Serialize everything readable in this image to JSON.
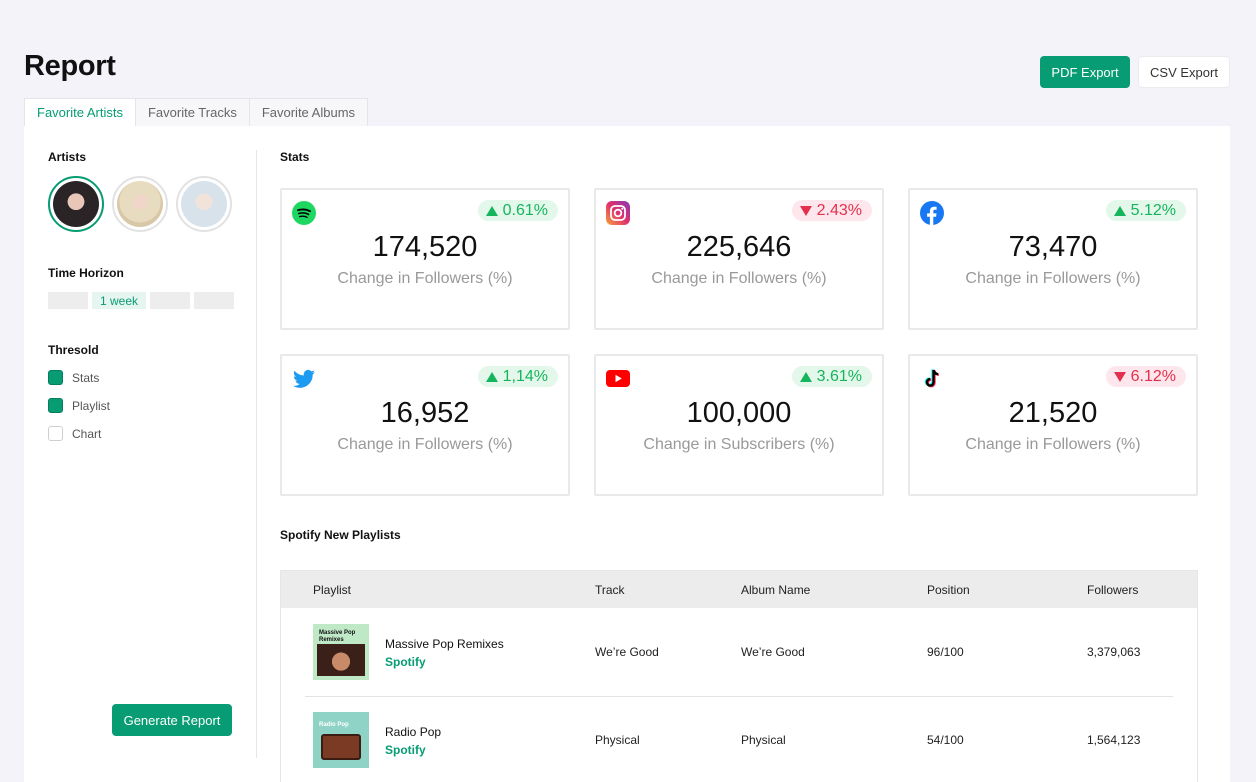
{
  "header": {
    "title": "Report",
    "pdf_export": "PDF Export",
    "csv_export": "CSV Export"
  },
  "tabs": [
    {
      "label": "Favorite Artists",
      "active": true
    },
    {
      "label": "Favorite Tracks",
      "active": false
    },
    {
      "label": "Favorite Albums",
      "active": false
    }
  ],
  "sidebar": {
    "artists_title": "Artists",
    "time_title": "Time Horizon",
    "time_options": [
      "",
      "1 week",
      "",
      ""
    ],
    "threshold_title": "Thresold",
    "checks": [
      {
        "label": "Stats",
        "checked": true
      },
      {
        "label": "Playlist",
        "checked": true
      },
      {
        "label": "Chart",
        "checked": false
      }
    ],
    "generate": "Generate Report"
  },
  "stats": {
    "title": "Stats",
    "cards": [
      {
        "platform": "spotify-icon",
        "change": "0.61%",
        "direction": "up",
        "value": "174,520",
        "label": "Change in Followers (%)"
      },
      {
        "platform": "instagram-icon",
        "change": "2.43%",
        "direction": "down",
        "value": "225,646",
        "label": "Change in Followers (%)"
      },
      {
        "platform": "facebook-icon",
        "change": "5.12%",
        "direction": "up",
        "value": "73,470",
        "label": "Change in Followers (%)"
      },
      {
        "platform": "twitter-icon",
        "change": "1,14%",
        "direction": "up",
        "value": "16,952",
        "label": "Change in Followers (%)"
      },
      {
        "platform": "youtube-icon",
        "change": "3.61%",
        "direction": "up",
        "value": "100,000",
        "label": "Change in Subscribers (%)"
      },
      {
        "platform": "tiktok-icon",
        "change": "6.12%",
        "direction": "down",
        "value": "21,520",
        "label": "Change in Followers (%)"
      }
    ]
  },
  "playlists": {
    "title": "Spotify New Playlists",
    "columns": [
      "Playlist",
      "Track",
      "Album Name",
      "Position",
      "Followers"
    ],
    "rows": [
      {
        "name": "Massive Pop Remixes",
        "source": "Spotify",
        "cover_text": "Massive Pop Remixes",
        "track": "We’re Good",
        "album": "We’re Good",
        "position": "96/100",
        "followers": "3,379,063"
      },
      {
        "name": "Radio Pop",
        "source": "Spotify",
        "cover_text": "Radio Pop",
        "track": "Physical",
        "album": "Physical",
        "position": "54/100",
        "followers": "1,564,123"
      }
    ]
  },
  "colors": {
    "accent": "#079c73",
    "up": "#16b45c",
    "down": "#e2304d"
  }
}
